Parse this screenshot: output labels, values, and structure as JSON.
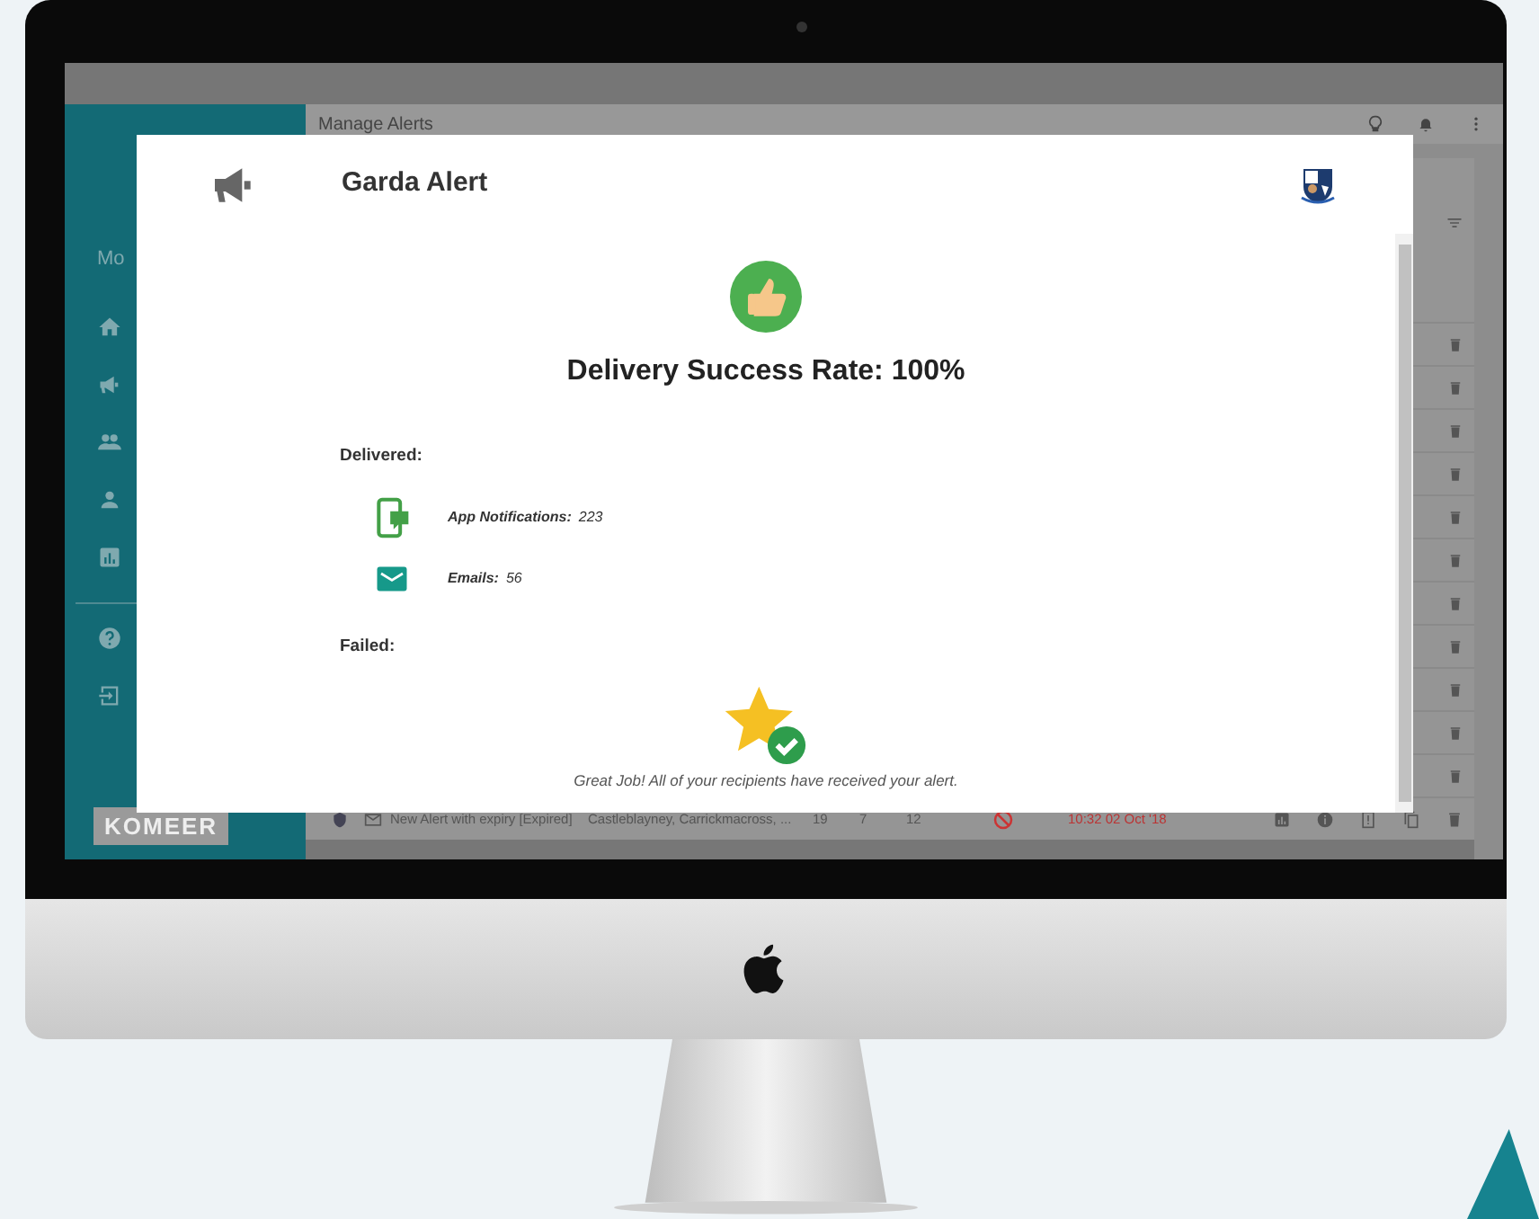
{
  "top_bar": {
    "page_title": "Manage Alerts"
  },
  "sidebar": {
    "section_label": "Mo",
    "logo": "KOMEER"
  },
  "table": {
    "visible_row": {
      "cells": [
        {
          "kind": "title",
          "text": "New Alert with expiry [Expired]"
        },
        {
          "kind": "recipients",
          "text": "Castleblayney, Carrickmacross, ..."
        },
        {
          "kind": "number",
          "text": "19"
        },
        {
          "kind": "number",
          "text": "7"
        },
        {
          "kind": "number",
          "text": "12"
        },
        {
          "kind": "time",
          "text": "10:32 02 Oct '18"
        }
      ]
    }
  },
  "modal": {
    "title": "Garda Alert",
    "headline": "Delivery Success Rate: 100%",
    "delivered_label": "Delivered:",
    "channels": [
      {
        "kind": "app",
        "label": "App Notifications:",
        "count": "223"
      },
      {
        "kind": "email",
        "label": "Emails:",
        "count": "56"
      }
    ],
    "failed_label": "Failed:",
    "message": "Great Job! All of your recipients have received your alert."
  }
}
